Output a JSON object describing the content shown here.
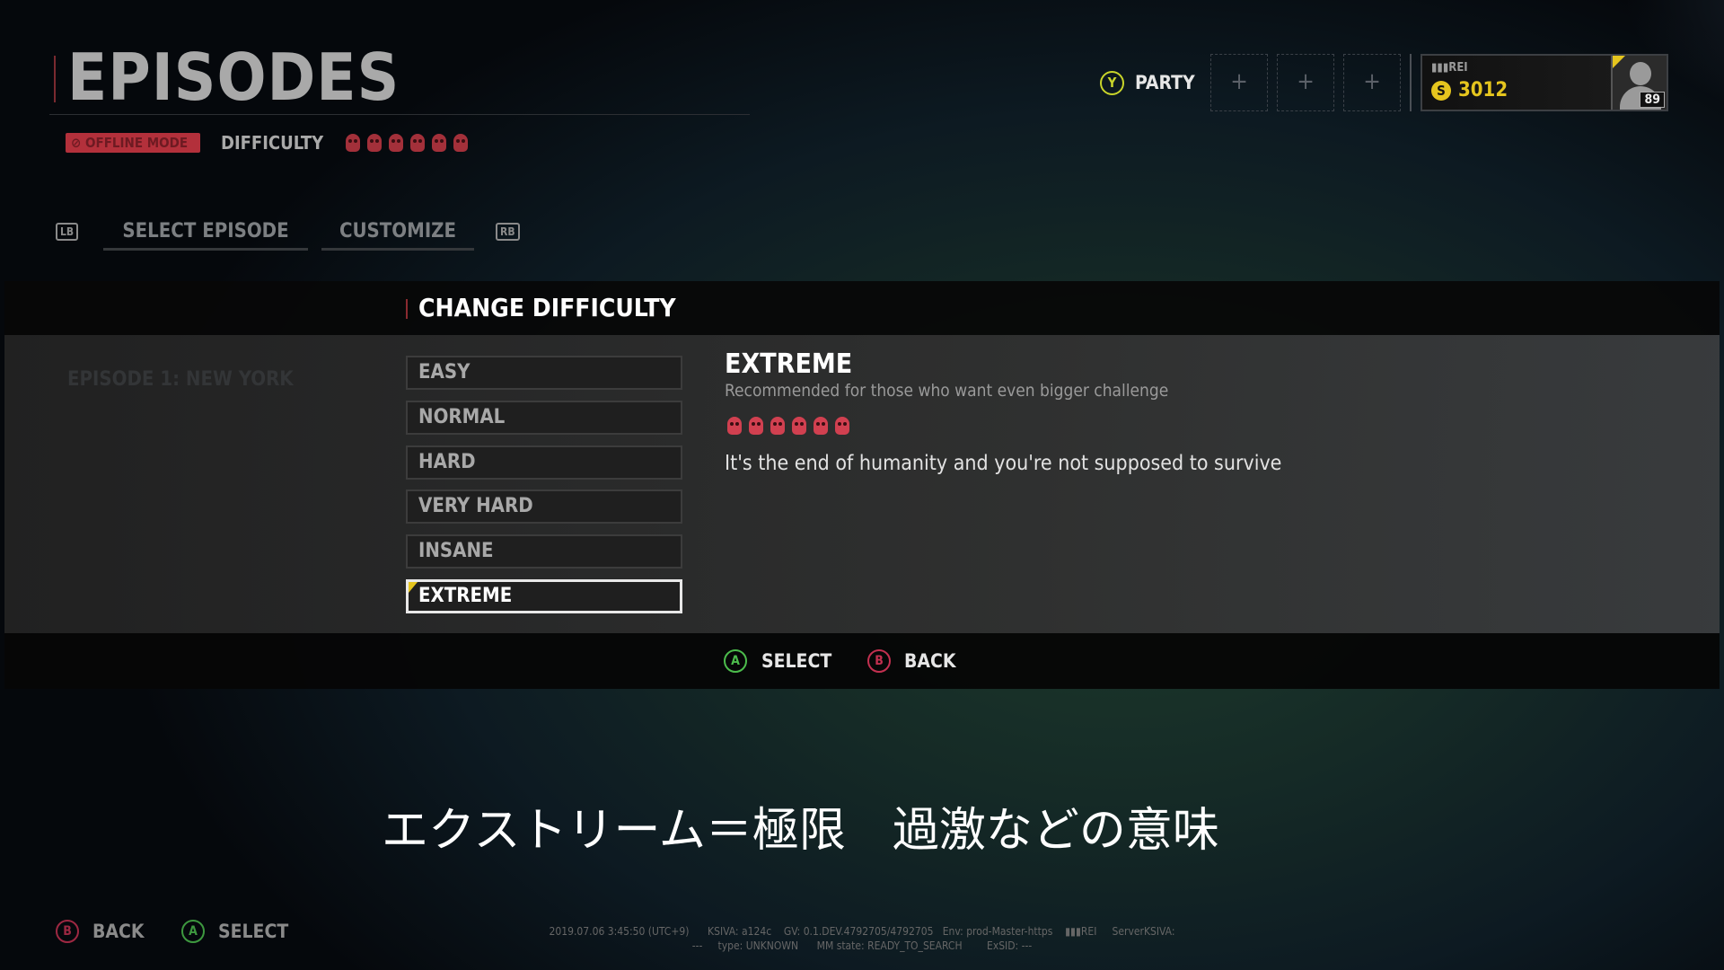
{
  "header": {
    "title": "EPISODES",
    "offline_badge": "OFFLINE MODE",
    "difficulty_label": "DIFFICULTY",
    "difficulty_level": 6
  },
  "tabs": {
    "lb": "LB",
    "rb": "RB",
    "items": [
      {
        "label": "SELECT EPISODE"
      },
      {
        "label": "CUSTOMIZE"
      }
    ]
  },
  "background_list": [
    "EPISODE 1: NEW YORK"
  ],
  "party": {
    "button": "Y",
    "label": "PARTY",
    "slot_icon": "+"
  },
  "player": {
    "name": "▮▮▮REI",
    "currency_icon": "S",
    "currency": "3012",
    "level": "89"
  },
  "dialog": {
    "title": "CHANGE DIFFICULTY",
    "options": [
      "EASY",
      "NORMAL",
      "HARD",
      "VERY HARD",
      "INSANE",
      "EXTREME"
    ],
    "selected": "EXTREME",
    "detail": {
      "title": "EXTREME",
      "subtitle": "Recommended for those who want even bigger challenge",
      "skulls": 6,
      "description": "It's the end of humanity and you're not supposed to survive"
    },
    "footer": {
      "a_button": "A",
      "select": "SELECT",
      "b_button": "B",
      "back": "BACK"
    }
  },
  "caption": "エクストリーム＝極限　過激などの意味",
  "bottom": {
    "b_button": "B",
    "back": "BACK",
    "a_button": "A",
    "select": "SELECT"
  },
  "debug": {
    "line1": "2019.07.06 3:45:50 (UTC+9)      KSIVA: a124c    GV: 0.1.DEV.4792705/4792705   Env: prod-Master-https    ▮▮▮REI     ServerKSIVA:",
    "line2": "---     type: UNKNOWN      MM state: READY_TO_SEARCH        ExSID: ---"
  },
  "colors": {
    "accent_yellow": "#e5c51e",
    "skull_red": "#d14050",
    "offline_red": "#b3303b",
    "a_green": "#4cbc4c",
    "b_red": "#c33050"
  }
}
